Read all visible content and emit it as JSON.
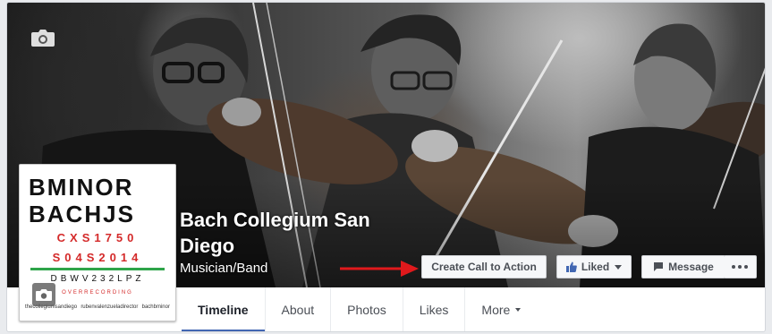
{
  "page": {
    "name": "Bach Collegium San Diego",
    "category": "Musician/Band"
  },
  "profile_logo": {
    "line1": "BMINOR",
    "line2": "BACHJS",
    "line3": "CXS1750",
    "line4": "S04S2014",
    "line5": "DBWV232LPZ",
    "line6": "OVERRECORDING",
    "footer_left": "thecollegiumsandiego",
    "footer_mid": "rubenvalenzueladirector",
    "footer_right": "bachbminor"
  },
  "actions": {
    "cta_label": "Create Call to Action",
    "liked_label": "Liked",
    "message_label": "Message"
  },
  "tabs": [
    {
      "label": "Timeline"
    },
    {
      "label": "About"
    },
    {
      "label": "Photos"
    },
    {
      "label": "Likes"
    },
    {
      "label": "More"
    }
  ],
  "colors": {
    "accent": "#4267b2",
    "arrow": "#e0191c",
    "logo_red": "#d42a2a",
    "logo_green": "#2ea44a"
  },
  "icons": {
    "cover_camera": "camera-icon",
    "profile_camera": "camera-icon",
    "liked": "thumbs-up-icon",
    "message": "speech-bubble-icon",
    "more": "ellipsis-icon"
  }
}
